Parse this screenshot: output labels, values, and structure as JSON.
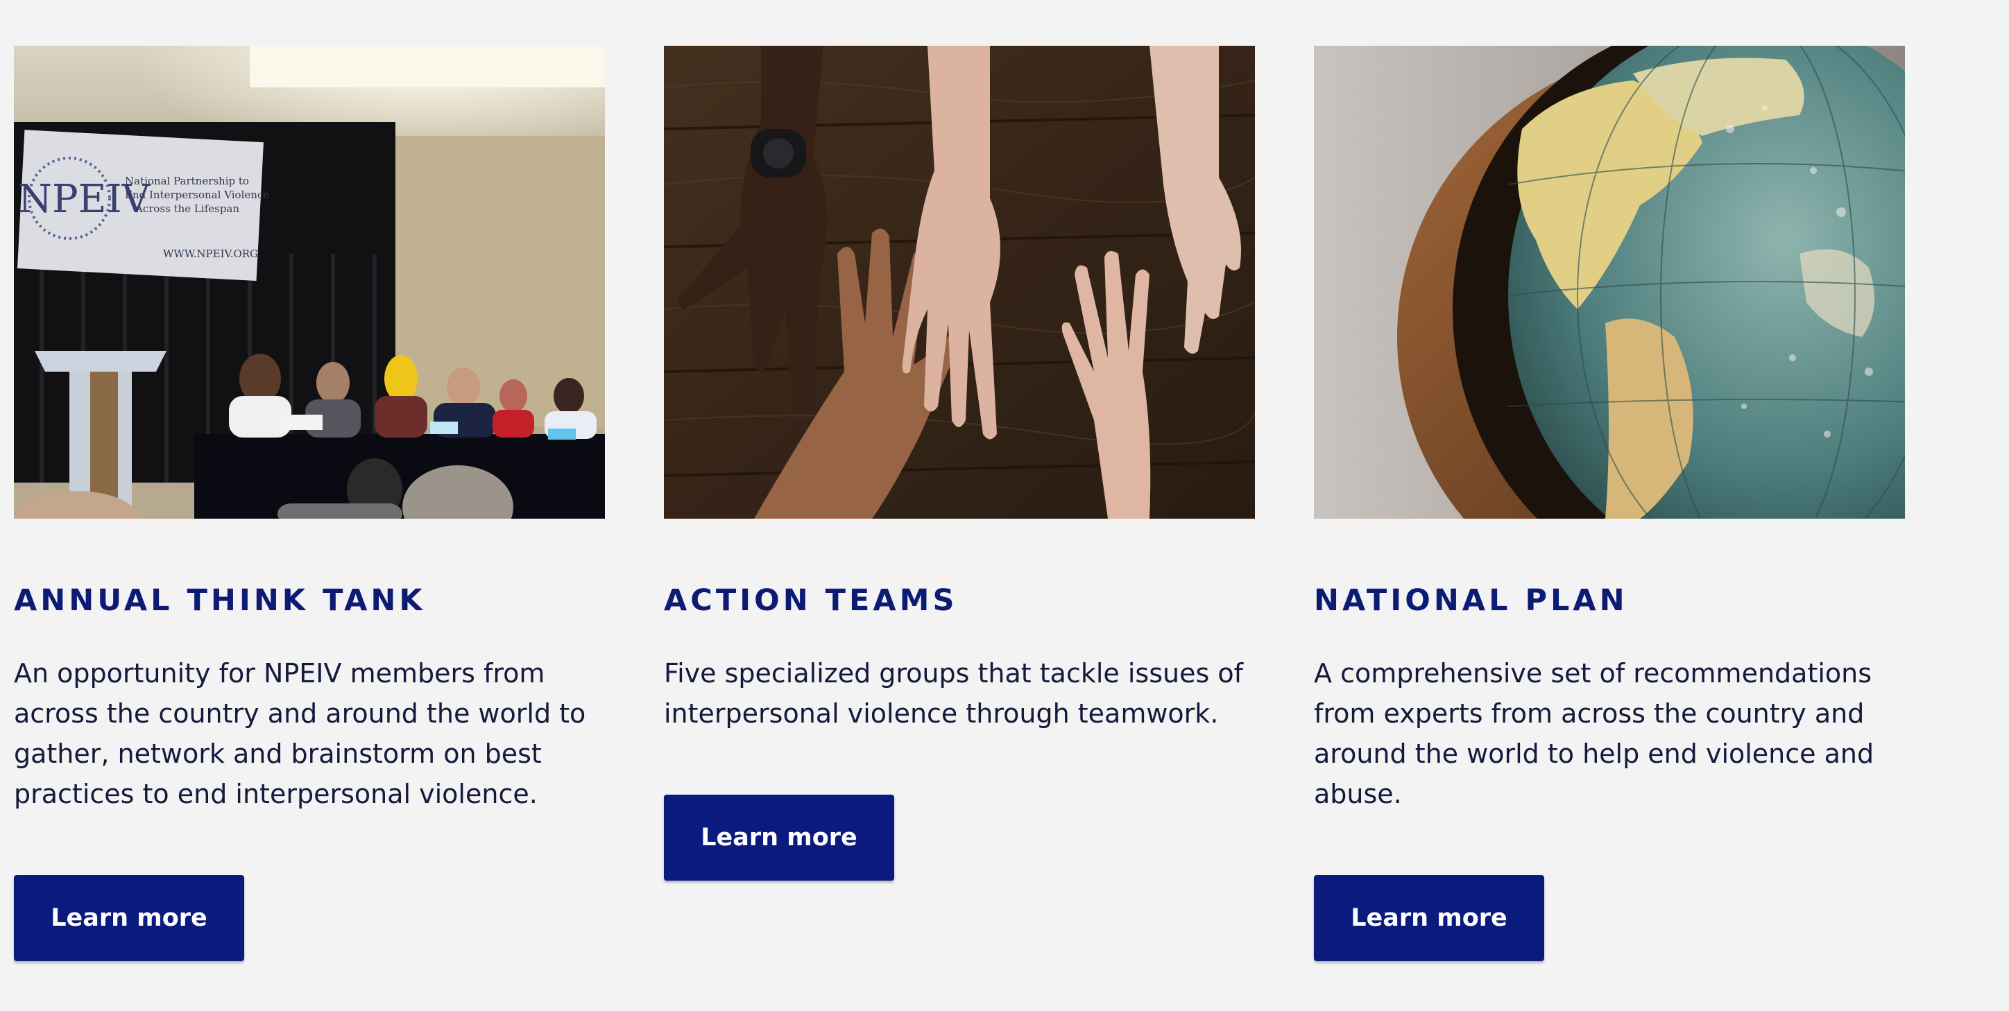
{
  "cards": [
    {
      "title": "ANNUAL THINK TANK",
      "description": "An opportunity for NPEIV members from across the country and around the world to gather, network and brainstorm on best practices to end interpersonal violence.",
      "button_label": "Learn more",
      "photo": {
        "subject": "panel-discussion-photo",
        "banner_logo": "NPEIV",
        "banner_lines": [
          "National Partnership to",
          "End Interpersonal Violence",
          "Across the Lifespan"
        ],
        "banner_url": "WWW.NPEIV.ORG"
      }
    },
    {
      "title": "ACTION TEAMS",
      "description": "Five specialized groups that tackle issues of interpersonal violence through teamwork.",
      "button_label": "Learn more",
      "photo": {
        "subject": "hands-on-table-photo"
      }
    },
    {
      "title": "NATIONAL PLAN",
      "description": "A comprehensive set of recommendations from experts from across the country and around the world to help end violence and abuse.",
      "button_label": "Learn more",
      "photo": {
        "subject": "globe-photo"
      }
    }
  ],
  "colors": {
    "background": "#f3f3f4",
    "title": "#0c1c74",
    "button": "#0b1b7d",
    "button_text": "#ffffff",
    "body_text": "#141a3a"
  }
}
